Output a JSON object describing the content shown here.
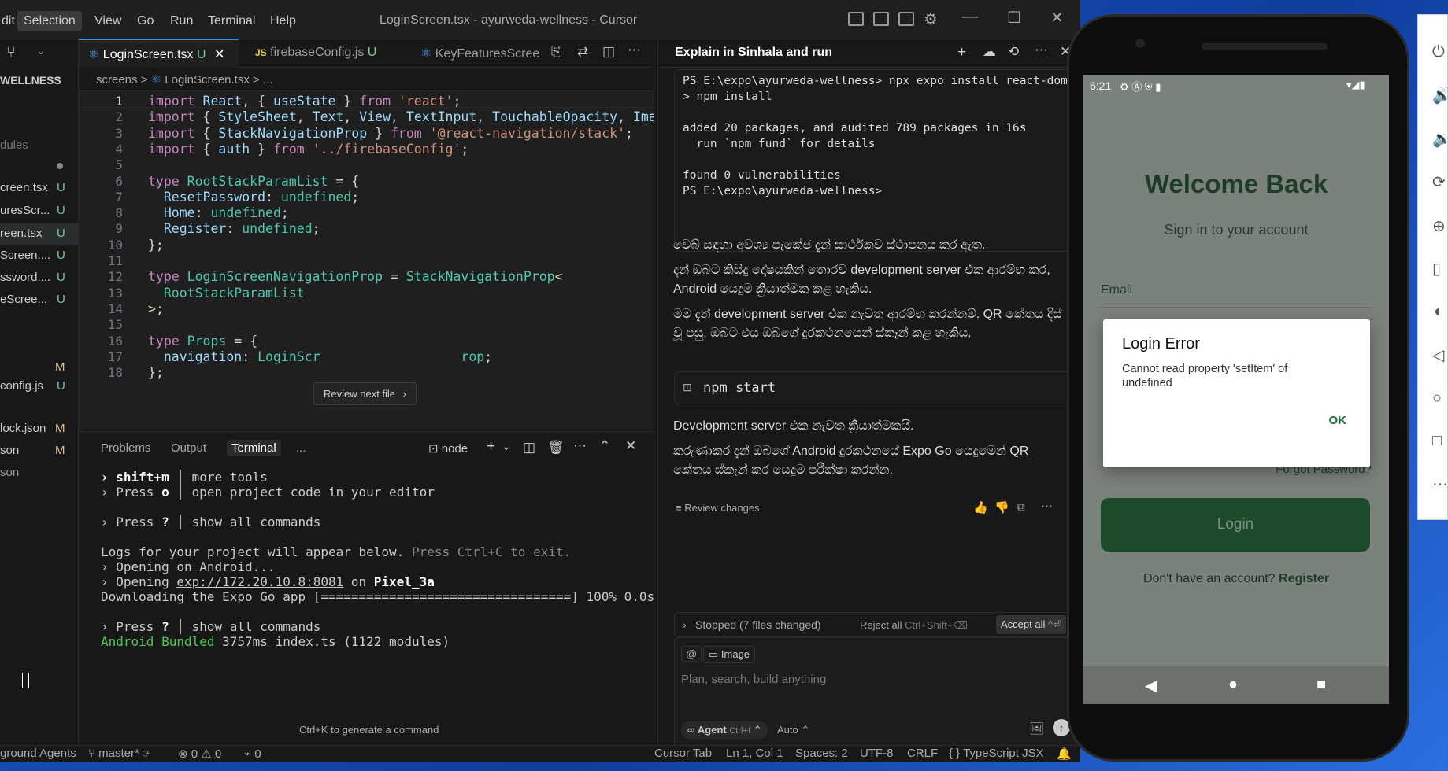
{
  "menu": [
    "dit",
    "Selection",
    "View",
    "Go",
    "Run",
    "Terminal",
    "Help"
  ],
  "window_title": "LoginScreen.tsx - ayurweda-wellness - Cursor",
  "explorer": {
    "section": "WELLNESS",
    "dim_label": "dules",
    "files": [
      {
        "name": "creen.tsx",
        "badge": "U"
      },
      {
        "name": "uresScr...",
        "badge": "U"
      },
      {
        "name": "reen.tsx",
        "badge": "U"
      },
      {
        "name": "Screen....",
        "badge": "U"
      },
      {
        "name": "ssword....",
        "badge": "U"
      },
      {
        "name": "eScree...",
        "badge": "U"
      },
      {
        "name": "config.js",
        "badge": "U"
      }
    ],
    "extra": [
      {
        "name": "",
        "badge": "M"
      },
      {
        "name": "lock.json",
        "badge": "M"
      },
      {
        "name": "son",
        "badge": "M"
      },
      {
        "name": "son",
        "badge": ""
      }
    ]
  },
  "tabs": [
    {
      "label": "LoginScreen.tsx",
      "badge": "U"
    },
    {
      "label": "firebaseConfig.js",
      "badge": "U"
    },
    {
      "label": "KeyFeaturesScree",
      "badge": ""
    }
  ],
  "breadcrumb": {
    "folder": "screens",
    "sep": ">",
    "file": "LoginScreen.tsx",
    "rest": "> ..."
  },
  "code": {
    "numbers": [
      "1",
      "2",
      "3",
      "4",
      "5",
      "6",
      "7",
      "8",
      "9",
      "10",
      "11",
      "12",
      "13",
      "14",
      "15",
      "16",
      "17",
      "18"
    ],
    "lines": [
      [
        [
          "kw",
          "import "
        ],
        [
          "id",
          "React"
        ],
        [
          "pu",
          ", { "
        ],
        [
          "id",
          "useState"
        ],
        [
          "pu",
          " } "
        ],
        [
          "kw",
          "from "
        ],
        [
          "st",
          "'react'"
        ],
        [
          "pu",
          ";"
        ]
      ],
      [
        [
          "kw",
          "import "
        ],
        [
          "pu",
          "{ "
        ],
        [
          "id",
          "StyleSheet"
        ],
        [
          "pu",
          ", "
        ],
        [
          "id",
          "Text"
        ],
        [
          "pu",
          ", "
        ],
        [
          "id",
          "View"
        ],
        [
          "pu",
          ", "
        ],
        [
          "id",
          "TextInput"
        ],
        [
          "pu",
          ", "
        ],
        [
          "id",
          "TouchableOpacity"
        ],
        [
          "pu",
          ", "
        ],
        [
          "id",
          "Image"
        ]
      ],
      [
        [
          "kw",
          "import "
        ],
        [
          "pu",
          "{ "
        ],
        [
          "id",
          "StackNavigationProp"
        ],
        [
          "pu",
          " } "
        ],
        [
          "kw",
          "from "
        ],
        [
          "st",
          "'@react-navigation/stack'"
        ],
        [
          "pu",
          ";"
        ]
      ],
      [
        [
          "kw",
          "import "
        ],
        [
          "pu",
          "{ "
        ],
        [
          "id",
          "auth"
        ],
        [
          "pu",
          " } "
        ],
        [
          "kw",
          "from "
        ],
        [
          "st",
          "'../firebaseConfig'"
        ],
        [
          "pu",
          ";"
        ]
      ],
      [],
      [
        [
          "kw",
          "type "
        ],
        [
          "ty",
          "RootStackParamList"
        ],
        [
          "pu",
          " = {"
        ]
      ],
      [
        [
          "pu",
          "  "
        ],
        [
          "id",
          "ResetPassword"
        ],
        [
          "pu",
          ": "
        ],
        [
          "ty",
          "undefined"
        ],
        [
          "pu",
          ";"
        ]
      ],
      [
        [
          "pu",
          "  "
        ],
        [
          "id",
          "Home"
        ],
        [
          "pu",
          ": "
        ],
        [
          "ty",
          "undefined"
        ],
        [
          "pu",
          ";"
        ]
      ],
      [
        [
          "pu",
          "  "
        ],
        [
          "id",
          "Register"
        ],
        [
          "pu",
          ": "
        ],
        [
          "ty",
          "undefined"
        ],
        [
          "pu",
          ";"
        ]
      ],
      [
        [
          "pu",
          "};"
        ]
      ],
      [],
      [
        [
          "kw",
          "type "
        ],
        [
          "ty",
          "LoginScreenNavigationProp"
        ],
        [
          "pu",
          " = "
        ],
        [
          "ty",
          "StackNavigationProp"
        ],
        [
          "yl",
          "<"
        ]
      ],
      [
        [
          "pu",
          "  "
        ],
        [
          "ty",
          "RootStackParamList"
        ]
      ],
      [
        [
          "yl",
          ">"
        ],
        [
          "pu",
          ";"
        ]
      ],
      [],
      [
        [
          "kw",
          "type "
        ],
        [
          "ty",
          "Props"
        ],
        [
          "pu",
          " = {"
        ]
      ],
      [
        [
          "pu",
          "  "
        ],
        [
          "id",
          "navigation"
        ],
        [
          "pu",
          ": "
        ],
        [
          "ty",
          "LoginScr"
        ],
        [
          "pu",
          "                  "
        ],
        [
          "ty",
          "rop"
        ],
        [
          "pu",
          ";"
        ]
      ],
      [
        [
          "pu",
          "};"
        ]
      ]
    ]
  },
  "tooltip": "Review next file",
  "panel": {
    "tabs": [
      "Problems",
      "Output",
      "Terminal",
      "..."
    ],
    "shell": "node"
  },
  "terminal": [
    [
      [
        "term-bold",
        "› shift+m "
      ],
      [
        "",
        "│ more tools"
      ]
    ],
    [
      [
        "",
        "› Press "
      ],
      [
        "term-bold",
        "o"
      ],
      [
        "",
        " │ open project code in your editor"
      ]
    ],
    [],
    [
      [
        "",
        "› Press "
      ],
      [
        "term-bold",
        "?"
      ],
      [
        "",
        " │ show all commands"
      ]
    ],
    [],
    [
      [
        "",
        "Logs for your project will appear below. "
      ],
      [
        "dim",
        "Press Ctrl+C to exit."
      ]
    ],
    [
      [
        "",
        "› Opening on Android..."
      ]
    ],
    [
      [
        "",
        "› Opening "
      ],
      [
        "u",
        "exp://172.20.10.8:8081"
      ],
      [
        "",
        " on "
      ],
      [
        "term-bold",
        "Pixel_3a"
      ]
    ],
    [
      [
        "",
        "Downloading the Expo Go app [=================================] 100% 0.0s"
      ]
    ],
    [],
    [
      [
        "",
        "› Press "
      ],
      [
        "term-bold",
        "?"
      ],
      [
        "",
        " │ show all commands"
      ]
    ],
    [
      [
        "green",
        "Android "
      ],
      [
        "green",
        "Bundled "
      ],
      [
        "",
        "3757ms index.ts (1122 modules)"
      ]
    ]
  ],
  "gen_hint": "Ctrl+K to generate a command",
  "chat": {
    "title": "Explain in Sinhala and run",
    "term_lines": [
      "PS E:\\expo\\ayurweda-wellness> npx expo install react-dom r",
      "> npm install",
      "",
      "added 20 packages, and audited 789 packages in 16s",
      "  run `npm fund` for details",
      "",
      "found 0 vulnerabilities",
      "PS E:\\expo\\ayurweda-wellness>"
    ],
    "p1": "වෙබ් සඳහා අවශ්‍ය පැකේජ දැන් සාර්ථකව ස්ථාපනය කර ඇත.",
    "p2": "දැන් ඔබට කිසිදු දෝෂයකින් තොරව development server එක ආරම්භ කර, Android යෙදුම ක්‍රියාත්මක කළ හැකිය.",
    "p3": "මම දැන් development server එක නැවත ආරම්භ කරන්නම්. QR කේතය දිස් වූ පසු, ඔබට එය ඔබගේ දුරකථනයෙන් ස්කෑන් කළ හැකිය.",
    "cmd": "npm start",
    "p4": "Development server එක නැවත ක්‍රියාත්මකයි.",
    "p5": "කරුණාකර දැන් ඔබගේ Android දුරකථනයේ Expo Go යෙදුමෙන් QR කේතය ස්කෑන් කර යෙදුම පරීක්ෂා කරන්න.",
    "review": "Review changes",
    "stopped": "Stopped (7 files changed)",
    "reject": "Reject all",
    "reject_kbd": "Ctrl+Shift+⌫",
    "accept": "Accept all",
    "accept_kbd": "^⏎",
    "image_chip": "Image",
    "placeholder": "Plan, search, build anything",
    "agent": "Agent",
    "agent_kbd": "Ctrl+I",
    "auto": "Auto"
  },
  "status": {
    "left": "ground Agents",
    "branch": "master*",
    "errors": "0",
    "warnings": "0",
    "ports": "0",
    "cursor_tab": "Cursor Tab",
    "position": "Ln 1, Col 1",
    "spaces": "Spaces: 2",
    "encoding": "UTF-8",
    "eol": "CRLF",
    "lang": "{ } TypeScript JSX"
  },
  "phone": {
    "time": "6:21",
    "welcome": "Welcome Back",
    "subtitle": "Sign in to your account",
    "email_label": "Email",
    "forgot": "Forgot Password?",
    "login": "Login",
    "no_account": "Don't have an account?",
    "register": "Register",
    "dialog": {
      "title": "Login Error",
      "message": "Cannot read property 'setItem' of undefined",
      "ok": "OK"
    }
  },
  "colors": {
    "accent": "#3c8cff",
    "app_green": "#1e4a2c",
    "badge_green": "#73c991",
    "badge_modified": "#e2c08d"
  }
}
